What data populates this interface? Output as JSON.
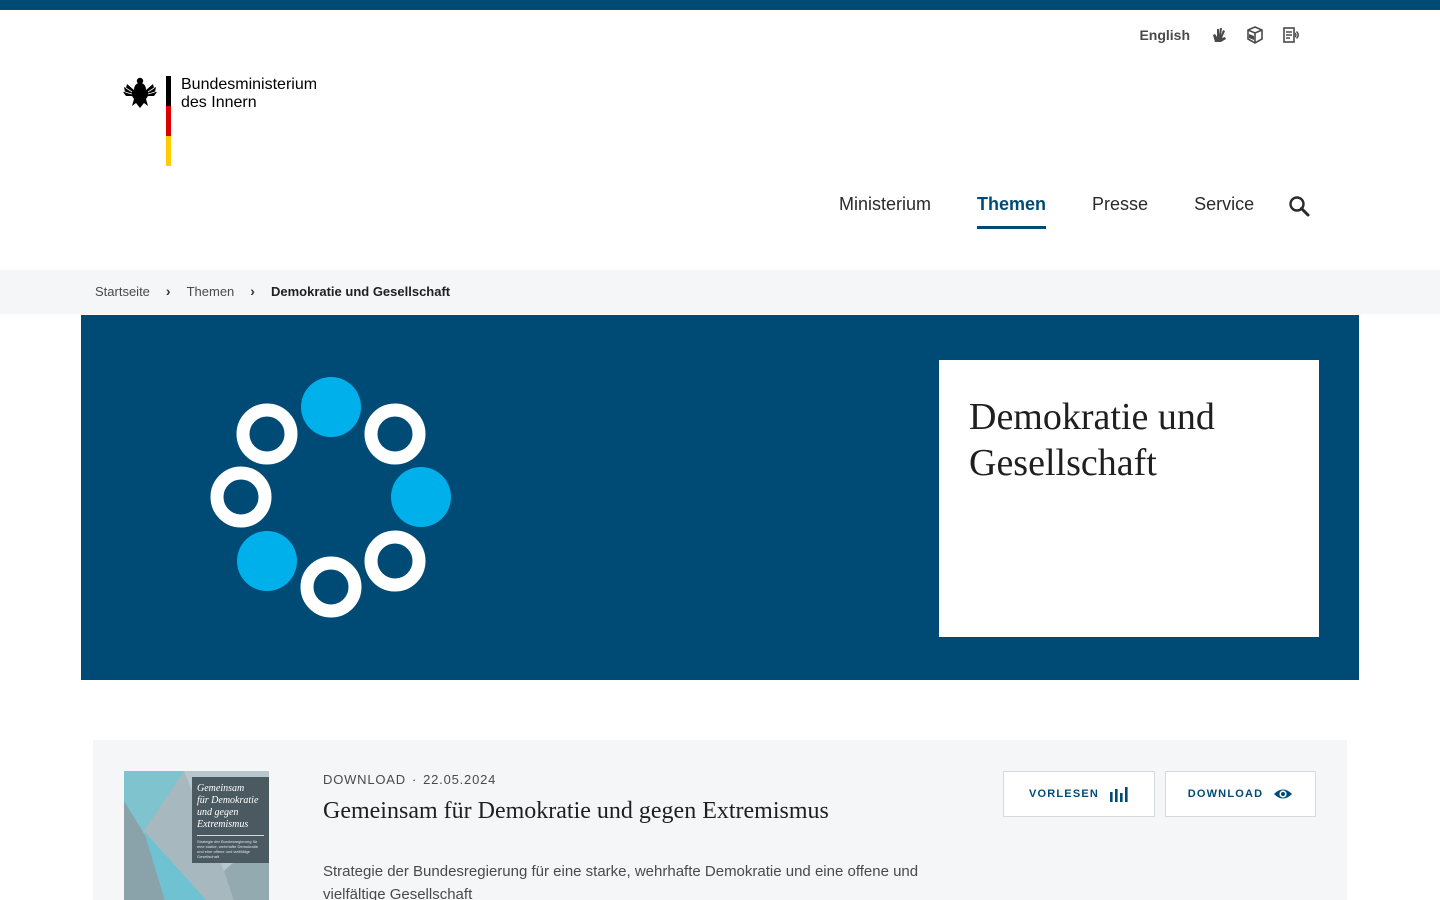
{
  "service": {
    "language_label": "English",
    "icons": [
      "sign-language-icon",
      "easy-language-icon",
      "read-aloud-icon"
    ]
  },
  "logo": {
    "line1": "Bundesministerium",
    "line2": "des Innern",
    "colors": {
      "black": "#000000",
      "red": "#dd0000",
      "gold": "#ffcc00"
    }
  },
  "nav": {
    "items": [
      {
        "label": "Ministerium",
        "active": false
      },
      {
        "label": "Themen",
        "active": true
      },
      {
        "label": "Presse",
        "active": false
      },
      {
        "label": "Service",
        "active": false
      }
    ],
    "search_icon": "search-icon"
  },
  "breadcrumb": {
    "items": [
      "Startseite",
      "Themen"
    ],
    "current": "Demokratie und Gesellschaft"
  },
  "hero": {
    "title_line1": "Demokratie und",
    "title_line2": "Gesellschaft",
    "background": "#004b76",
    "accent": "#00b0ea"
  },
  "teaser": {
    "type": "DOWNLOAD",
    "date": "22.05.2024",
    "title": "Gemeinsam für Demokratie und gegen Extremismus",
    "description": "Strategie der Bundesregierung für eine starke, wehrhafte Demokratie und eine offene und vielfältige Gesellschaft",
    "cover": {
      "title_lines": [
        "Gemeinsam",
        "für Demokratie",
        "und gegen",
        "Extremismus"
      ],
      "subtitle": "Strategie der Bundesregierung für eine starke, wehrhafte Demokratie und eine offene und vielfältige Gesellschaft"
    },
    "buttons": {
      "read_label": "VORLESEN",
      "download_label": "DOWNLOAD"
    }
  },
  "colors": {
    "primary": "#004b76",
    "light_bg": "#f4f6f8"
  }
}
